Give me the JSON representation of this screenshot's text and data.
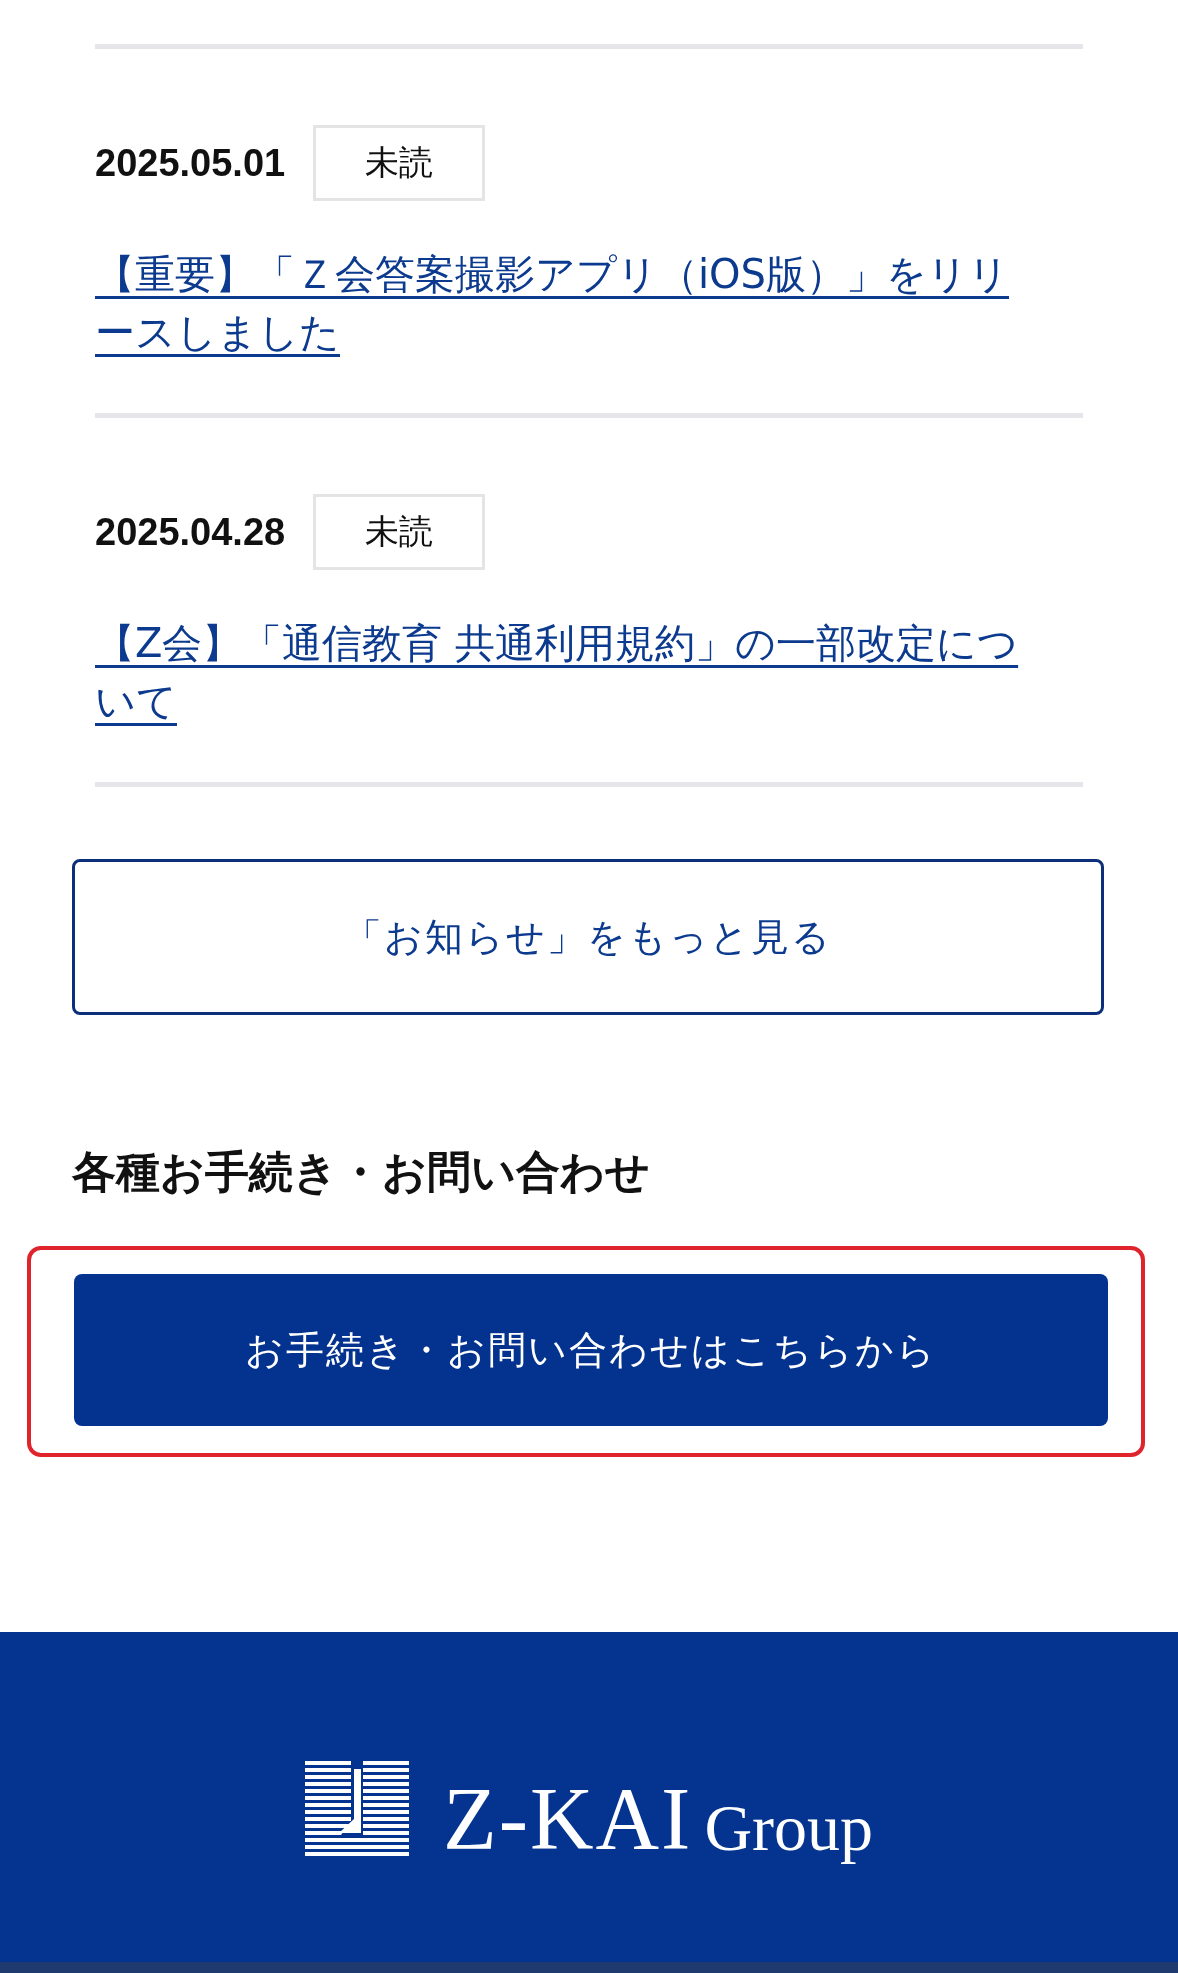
{
  "news": [
    {
      "date": "2025.05.01",
      "badge": "未読",
      "title": "【重要】「Ｚ会答案撮影アプリ（iOS版）」をリリースしました"
    },
    {
      "date": "2025.04.28",
      "badge": "未読",
      "title": "【Z会】「通信教育 共通利用規約」の一部改定について"
    }
  ],
  "more_button": "「お知らせ」をもっと見る",
  "section": {
    "heading": "各種お手続き・お問い合わせ",
    "button": "お手続き・お問い合わせはこちらから",
    "highlighted": true
  },
  "footer": {
    "logo_main": "Z-KAI",
    "logo_sub": "Group"
  }
}
